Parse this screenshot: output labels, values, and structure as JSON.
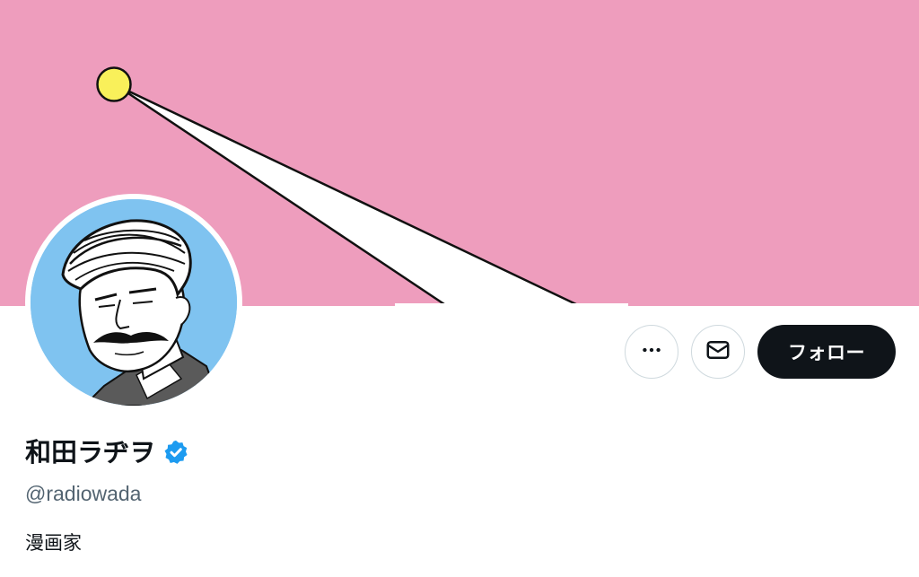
{
  "profile": {
    "display_name": "和田ラヂヲ",
    "handle": "@radiowada",
    "bio": "漫画家",
    "verified": true
  },
  "actions": {
    "more_icon": "more-horizontal-icon",
    "message_icon": "envelope-icon",
    "follow_label": "フォロー"
  },
  "colors": {
    "banner_pink": "#ee9dbd",
    "sun_yellow": "#f9f05a",
    "avatar_background": "#7fc3f0",
    "verified_blue": "#1d9bf0",
    "follow_button": "#0f1419",
    "handle_gray": "#536471"
  }
}
